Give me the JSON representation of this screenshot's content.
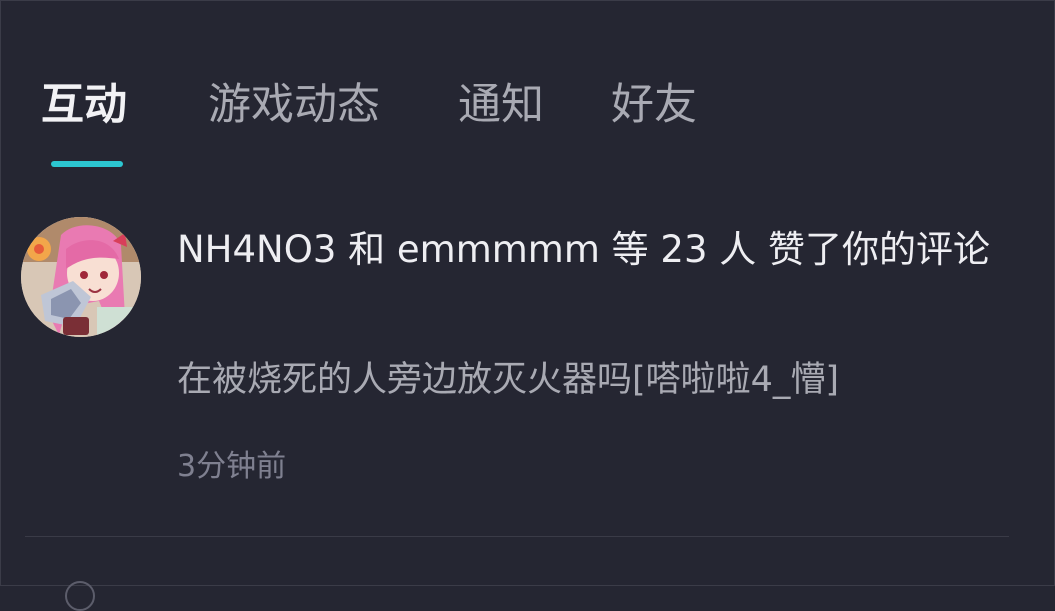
{
  "tabs": [
    {
      "label": "互动",
      "active": true
    },
    {
      "label": "游戏动态",
      "active": false
    },
    {
      "label": "通知",
      "active": false
    },
    {
      "label": "好友",
      "active": false
    }
  ],
  "notification": {
    "title": "NH4NO3 和 emmmmm 等 23 人 赞了你的评论",
    "quote": "在被烧死的人旁边放灭火器吗[嗒啦啦4_懵]",
    "time": "3分钟前"
  },
  "colors": {
    "background": "#252632",
    "accent": "#2cc6d1",
    "text_primary": "#eeeef2",
    "text_secondary": "#a9aab3",
    "text_muted": "#7f8090"
  },
  "icons": {
    "avatar": "user-avatar"
  }
}
